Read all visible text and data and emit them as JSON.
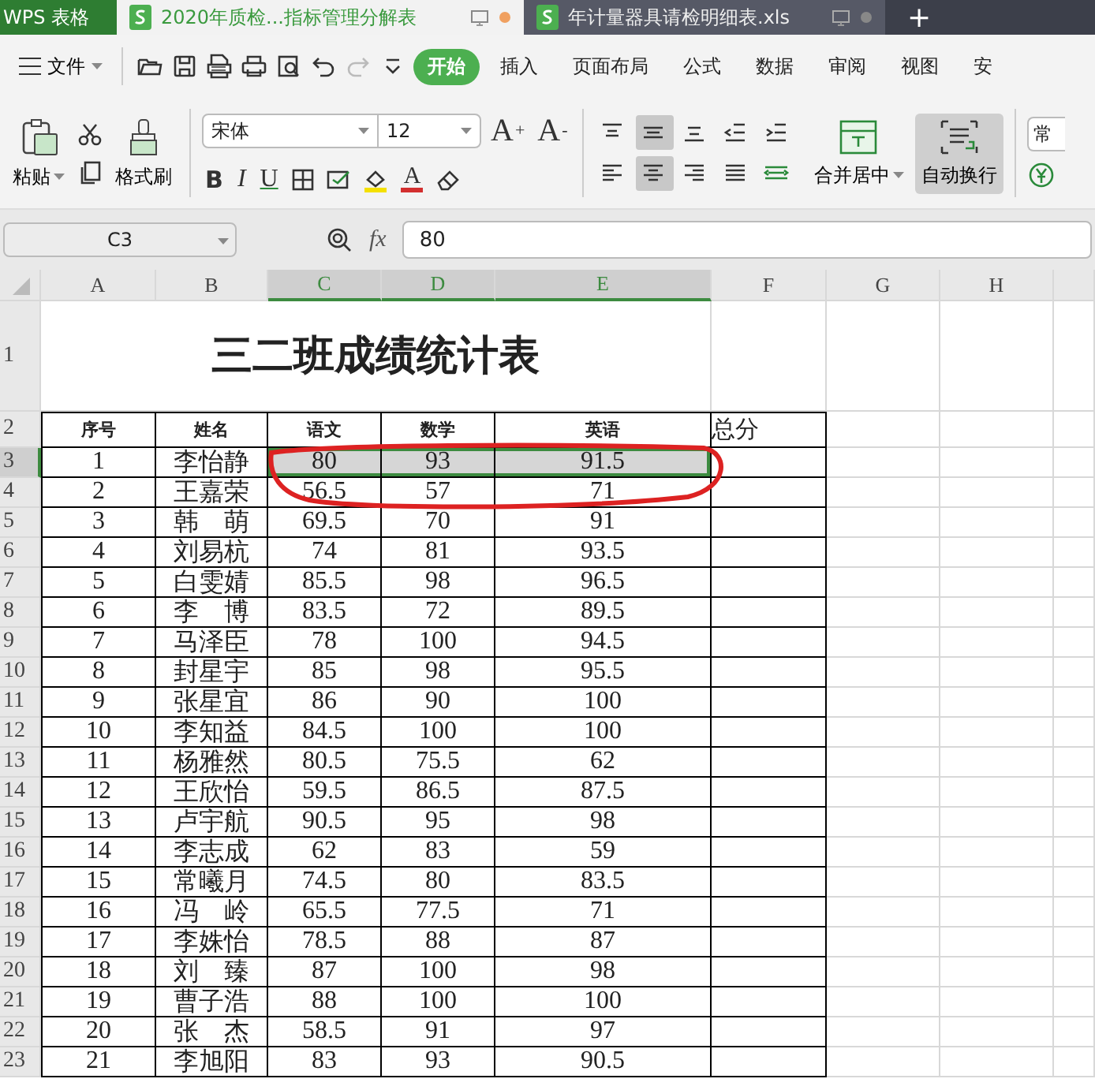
{
  "app_name": "WPS 表格",
  "doc_tabs": [
    {
      "label": "2020年质检...指标管理分解表",
      "selected": true
    },
    {
      "label": "年计量器具请检明细表.xls",
      "selected": false
    }
  ],
  "new_tab": "+",
  "menu": {
    "file": "文件",
    "tabs": [
      {
        "label": "开始",
        "selected": true
      },
      {
        "label": "插入",
        "selected": false
      },
      {
        "label": "页面布局",
        "selected": false
      },
      {
        "label": "公式",
        "selected": false
      },
      {
        "label": "数据",
        "selected": false
      },
      {
        "label": "审阅",
        "selected": false
      },
      {
        "label": "视图",
        "selected": false
      },
      {
        "label": "安",
        "selected": false
      }
    ]
  },
  "ribbon": {
    "paste": "粘贴",
    "format_painter": "格式刷",
    "font": "宋体",
    "size": "12",
    "grow": "A",
    "grow_mark": "+",
    "shrink": "A",
    "shrink_mark": "-",
    "bold": "B",
    "italic": "I",
    "underline": "U",
    "font_color": "A",
    "align_buttons": [
      {
        "kind": "top",
        "on": false
      },
      {
        "kind": "middle",
        "on": true
      },
      {
        "kind": "bottom",
        "on": false
      },
      {
        "kind": "outdent",
        "on": false
      },
      {
        "kind": "indent",
        "on": false
      },
      {
        "kind": "left",
        "on": false
      },
      {
        "kind": "center",
        "on": true
      },
      {
        "kind": "right",
        "on": false
      },
      {
        "kind": "justify",
        "on": false
      },
      {
        "kind": "distribute",
        "on": false
      }
    ],
    "merge": "合并居中",
    "wrap": {
      "label": "自动换行",
      "on": true
    },
    "number_format": "常"
  },
  "formula_bar": {
    "name_box": "C3",
    "fx": "fx",
    "value": "80"
  },
  "columns": [
    {
      "label": "A",
      "selected": false
    },
    {
      "label": "B",
      "selected": false
    },
    {
      "label": "C",
      "selected": true
    },
    {
      "label": "D",
      "selected": true
    },
    {
      "label": "E",
      "selected": true
    },
    {
      "label": "F",
      "selected": false
    },
    {
      "label": "G",
      "selected": false
    },
    {
      "label": "H",
      "selected": false
    }
  ],
  "sheet": {
    "title_row": "1",
    "header_row": "2",
    "title": "三二班成绩统计表",
    "headers": [
      "序号",
      "姓名",
      "语文",
      "数学",
      "英语"
    ],
    "extra_header": "总分",
    "rows": [
      {
        "n": "3",
        "selected": true,
        "cells": [
          {
            "t": "1",
            "selected": false
          },
          {
            "t": "李怡静",
            "selected": false
          },
          {
            "t": "80",
            "selected": true
          },
          {
            "t": "93",
            "selected": true
          },
          {
            "t": "91.5",
            "selected": true
          }
        ]
      },
      {
        "n": "4",
        "selected": false,
        "cells": [
          {
            "t": "2",
            "selected": false
          },
          {
            "t": "王嘉荣",
            "selected": false
          },
          {
            "t": "56.5",
            "selected": false
          },
          {
            "t": "57",
            "selected": false
          },
          {
            "t": "71",
            "selected": false
          }
        ]
      },
      {
        "n": "5",
        "selected": false,
        "cells": [
          {
            "t": "3",
            "selected": false
          },
          {
            "t": "韩　萌",
            "selected": false
          },
          {
            "t": "69.5",
            "selected": false
          },
          {
            "t": "70",
            "selected": false
          },
          {
            "t": "91",
            "selected": false
          }
        ]
      },
      {
        "n": "6",
        "selected": false,
        "cells": [
          {
            "t": "4",
            "selected": false
          },
          {
            "t": "刘易杭",
            "selected": false
          },
          {
            "t": "74",
            "selected": false
          },
          {
            "t": "81",
            "selected": false
          },
          {
            "t": "93.5",
            "selected": false
          }
        ]
      },
      {
        "n": "7",
        "selected": false,
        "cells": [
          {
            "t": "5",
            "selected": false
          },
          {
            "t": "白雯婧",
            "selected": false
          },
          {
            "t": "85.5",
            "selected": false
          },
          {
            "t": "98",
            "selected": false
          },
          {
            "t": "96.5",
            "selected": false
          }
        ]
      },
      {
        "n": "8",
        "selected": false,
        "cells": [
          {
            "t": "6",
            "selected": false
          },
          {
            "t": "李　博",
            "selected": false
          },
          {
            "t": "83.5",
            "selected": false
          },
          {
            "t": "72",
            "selected": false
          },
          {
            "t": "89.5",
            "selected": false
          }
        ]
      },
      {
        "n": "9",
        "selected": false,
        "cells": [
          {
            "t": "7",
            "selected": false
          },
          {
            "t": "马泽臣",
            "selected": false
          },
          {
            "t": "78",
            "selected": false
          },
          {
            "t": "100",
            "selected": false
          },
          {
            "t": "94.5",
            "selected": false
          }
        ]
      },
      {
        "n": "10",
        "selected": false,
        "cells": [
          {
            "t": "8",
            "selected": false
          },
          {
            "t": "封星宇",
            "selected": false
          },
          {
            "t": "85",
            "selected": false
          },
          {
            "t": "98",
            "selected": false
          },
          {
            "t": "95.5",
            "selected": false
          }
        ]
      },
      {
        "n": "11",
        "selected": false,
        "cells": [
          {
            "t": "9",
            "selected": false
          },
          {
            "t": "张星宜",
            "selected": false
          },
          {
            "t": "86",
            "selected": false
          },
          {
            "t": "90",
            "selected": false
          },
          {
            "t": "100",
            "selected": false
          }
        ]
      },
      {
        "n": "12",
        "selected": false,
        "cells": [
          {
            "t": "10",
            "selected": false
          },
          {
            "t": "李知益",
            "selected": false
          },
          {
            "t": "84.5",
            "selected": false
          },
          {
            "t": "100",
            "selected": false
          },
          {
            "t": "100",
            "selected": false
          }
        ]
      },
      {
        "n": "13",
        "selected": false,
        "cells": [
          {
            "t": "11",
            "selected": false
          },
          {
            "t": "杨雅然",
            "selected": false
          },
          {
            "t": "80.5",
            "selected": false
          },
          {
            "t": "75.5",
            "selected": false
          },
          {
            "t": "62",
            "selected": false
          }
        ]
      },
      {
        "n": "14",
        "selected": false,
        "cells": [
          {
            "t": "12",
            "selected": false
          },
          {
            "t": "王欣怡",
            "selected": false
          },
          {
            "t": "59.5",
            "selected": false
          },
          {
            "t": "86.5",
            "selected": false
          },
          {
            "t": "87.5",
            "selected": false
          }
        ]
      },
      {
        "n": "15",
        "selected": false,
        "cells": [
          {
            "t": "13",
            "selected": false
          },
          {
            "t": "卢宇航",
            "selected": false
          },
          {
            "t": "90.5",
            "selected": false
          },
          {
            "t": "95",
            "selected": false
          },
          {
            "t": "98",
            "selected": false
          }
        ]
      },
      {
        "n": "16",
        "selected": false,
        "cells": [
          {
            "t": "14",
            "selected": false
          },
          {
            "t": "李志成",
            "selected": false
          },
          {
            "t": "62",
            "selected": false
          },
          {
            "t": "83",
            "selected": false
          },
          {
            "t": "59",
            "selected": false
          }
        ]
      },
      {
        "n": "17",
        "selected": false,
        "cells": [
          {
            "t": "15",
            "selected": false
          },
          {
            "t": "常曦月",
            "selected": false
          },
          {
            "t": "74.5",
            "selected": false
          },
          {
            "t": "80",
            "selected": false
          },
          {
            "t": "83.5",
            "selected": false
          }
        ]
      },
      {
        "n": "18",
        "selected": false,
        "cells": [
          {
            "t": "16",
            "selected": false
          },
          {
            "t": "冯　岭",
            "selected": false
          },
          {
            "t": "65.5",
            "selected": false
          },
          {
            "t": "77.5",
            "selected": false
          },
          {
            "t": "71",
            "selected": false
          }
        ]
      },
      {
        "n": "19",
        "selected": false,
        "cells": [
          {
            "t": "17",
            "selected": false
          },
          {
            "t": "李姝怡",
            "selected": false
          },
          {
            "t": "78.5",
            "selected": false
          },
          {
            "t": "88",
            "selected": false
          },
          {
            "t": "87",
            "selected": false
          }
        ]
      },
      {
        "n": "20",
        "selected": false,
        "cells": [
          {
            "t": "18",
            "selected": false
          },
          {
            "t": "刘　臻",
            "selected": false
          },
          {
            "t": "87",
            "selected": false
          },
          {
            "t": "100",
            "selected": false
          },
          {
            "t": "98",
            "selected": false
          }
        ]
      },
      {
        "n": "21",
        "selected": false,
        "cells": [
          {
            "t": "19",
            "selected": false
          },
          {
            "t": "曹子浩",
            "selected": false
          },
          {
            "t": "88",
            "selected": false
          },
          {
            "t": "100",
            "selected": false
          },
          {
            "t": "100",
            "selected": false
          }
        ]
      },
      {
        "n": "22",
        "selected": false,
        "cells": [
          {
            "t": "20",
            "selected": false
          },
          {
            "t": "张　杰",
            "selected": false
          },
          {
            "t": "58.5",
            "selected": false
          },
          {
            "t": "91",
            "selected": false
          },
          {
            "t": "97",
            "selected": false
          }
        ]
      },
      {
        "n": "23",
        "selected": false,
        "cells": [
          {
            "t": "21",
            "selected": false
          },
          {
            "t": "李旭阳",
            "selected": false
          },
          {
            "t": "83",
            "selected": false
          },
          {
            "t": "93",
            "selected": false
          },
          {
            "t": "90.5",
            "selected": false
          }
        ]
      }
    ]
  }
}
